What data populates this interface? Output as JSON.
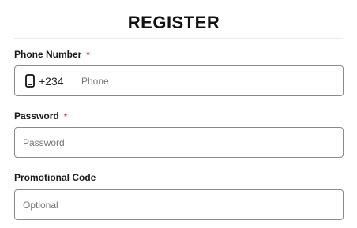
{
  "form": {
    "title": "REGISTER",
    "phone": {
      "label": "Phone Number",
      "required_mark": "*",
      "country_code": "+234",
      "icon": "mobile-phone-icon",
      "placeholder": "Phone",
      "value": ""
    },
    "password": {
      "label": "Password",
      "required_mark": "*",
      "placeholder": "Password",
      "value": ""
    },
    "promo": {
      "label": "Promotional Code",
      "placeholder": "Optional",
      "value": ""
    }
  },
  "colors": {
    "required": "#e24c4c",
    "border": "#8a8a8a",
    "placeholder": "#777777"
  }
}
